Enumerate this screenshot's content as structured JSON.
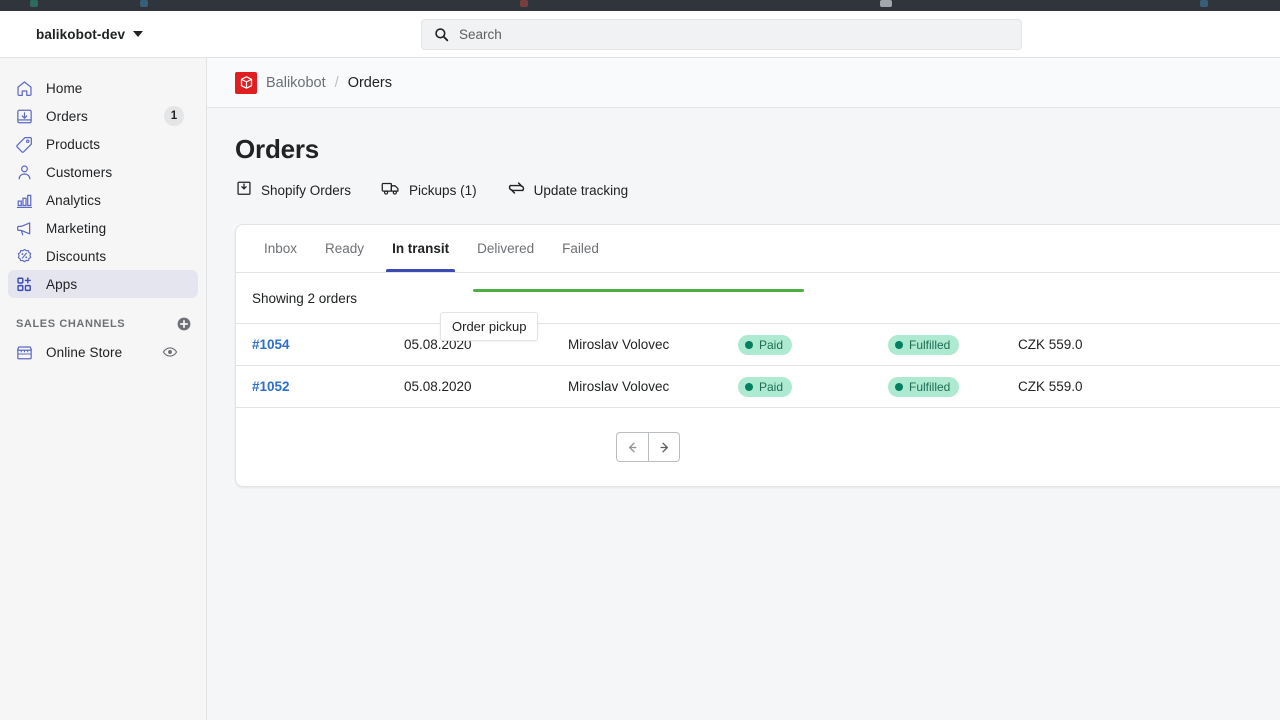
{
  "window": {
    "chrome_strip_color": "#2F353B"
  },
  "topbar": {
    "store_name": "balikobot-dev",
    "store_switcher_icon": "chevron-down-icon",
    "search": {
      "icon": "search-icon",
      "placeholder": "Search",
      "value": ""
    }
  },
  "sidebar": {
    "items": [
      {
        "label": "Home",
        "icon": "home-icon",
        "badge": null,
        "active": false
      },
      {
        "label": "Orders",
        "icon": "inbox-download-icon",
        "badge": "1",
        "active": false
      },
      {
        "label": "Products",
        "icon": "tag-icon",
        "badge": null,
        "active": false
      },
      {
        "label": "Customers",
        "icon": "person-icon",
        "badge": null,
        "active": false
      },
      {
        "label": "Analytics",
        "icon": "bar-chart-icon",
        "badge": null,
        "active": false
      },
      {
        "label": "Marketing",
        "icon": "megaphone-icon",
        "badge": null,
        "active": false
      },
      {
        "label": "Discounts",
        "icon": "discount-badge-icon",
        "badge": null,
        "active": false
      },
      {
        "label": "Apps",
        "icon": "apps-grid-icon",
        "badge": null,
        "active": true
      }
    ],
    "section": {
      "title": "SALES CHANNELS",
      "add_icon": "plus-circle-icon",
      "channels": [
        {
          "label": "Online Store",
          "icon": "storefront-icon",
          "trailing_icon": "eye-icon"
        }
      ]
    },
    "active_highlight_color": "#E4E5EF"
  },
  "breadcrumb": {
    "logo_icon": "balikobot-cube-logo",
    "logo_color": "#E02020",
    "app_name": "Balikobot",
    "separator": "/",
    "current": "Orders"
  },
  "page": {
    "title": "Orders",
    "actions": [
      {
        "label": "Shopify Orders",
        "icon": "import-orders-icon"
      },
      {
        "label": "Pickups (1)",
        "icon": "truck-icon"
      },
      {
        "label": "Update tracking",
        "icon": "refresh-sync-icon"
      }
    ]
  },
  "card": {
    "tabs": [
      {
        "label": "Inbox",
        "active": false
      },
      {
        "label": "Ready",
        "active": false
      },
      {
        "label": "In transit",
        "active": true
      },
      {
        "label": "Delivered",
        "active": false
      },
      {
        "label": "Failed",
        "active": false
      }
    ],
    "active_tab_underline_color": "#3C4AB5",
    "progress": {
      "visible": true,
      "color": "#4CAF41",
      "percent": 100
    },
    "showing_text": "Showing 2 orders",
    "rows": [
      {
        "order": "#1054",
        "date": "05.08.2020",
        "customer": "Miroslav Volovec",
        "payment": "Paid",
        "fulfillment": "Fulfilled",
        "total": "CZK 559.0"
      },
      {
        "order": "#1052",
        "date": "05.08.2020",
        "customer": "Miroslav Volovec",
        "payment": "Paid",
        "fulfillment": "Fulfilled",
        "total": "CZK 559.0"
      }
    ],
    "badge_colors": {
      "background": "#AEE9D1",
      "text": "#1C6D54",
      "dot": "#008060"
    },
    "pagination": {
      "prev_icon": "arrow-left-icon",
      "next_icon": "arrow-right-icon",
      "prev_enabled": false,
      "next_enabled": true
    }
  },
  "tooltip": {
    "text": "Order pickup"
  }
}
